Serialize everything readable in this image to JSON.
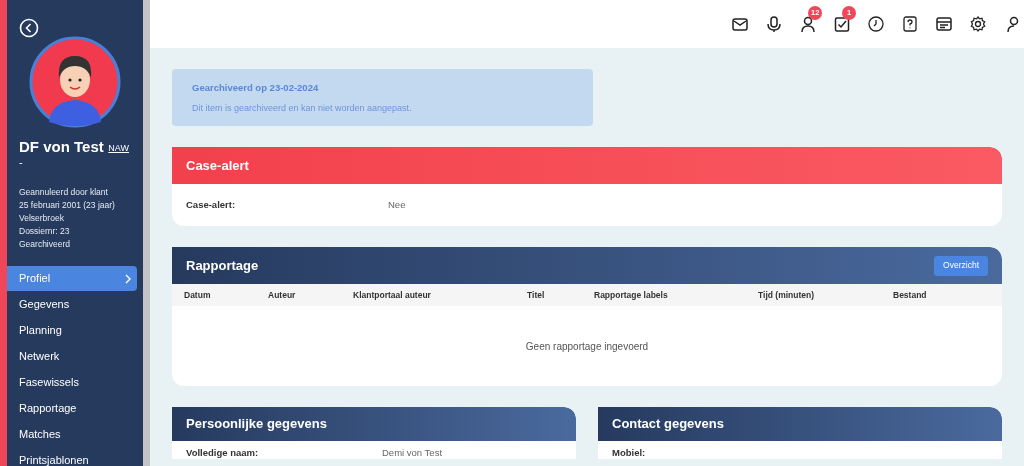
{
  "sidebar": {
    "name": "DF von Test",
    "subtitle": "-",
    "naw_link": "NAW",
    "details": [
      "Geannuleerd door klant",
      "25 februari 2001 (23 jaar)",
      "Velserbroek",
      "Dossiernr: 23",
      "Gearchiveerd"
    ],
    "items": [
      {
        "label": "Profiel",
        "selected": true
      },
      {
        "label": "Gegevens",
        "selected": false
      },
      {
        "label": "Planning",
        "selected": false
      },
      {
        "label": "Netwerk",
        "selected": false
      },
      {
        "label": "Fasewissels",
        "selected": false
      },
      {
        "label": "Rapportage",
        "selected": false
      },
      {
        "label": "Matches",
        "selected": false
      },
      {
        "label": "Printsjablonen",
        "selected": false
      }
    ]
  },
  "toolbar": [
    {
      "kind": "mail"
    },
    {
      "kind": "mic"
    },
    {
      "kind": "person",
      "badge": "12"
    },
    {
      "kind": "task",
      "badge": "1"
    },
    {
      "kind": "clock"
    },
    {
      "kind": "help"
    },
    {
      "kind": "card"
    },
    {
      "kind": "settings"
    },
    {
      "kind": "user"
    }
  ],
  "archive_notice": {
    "title": "Gearchiveerd op 23-02-2024",
    "text": "Dit item is gearchiveerd en kan niet worden aangepast."
  },
  "case_alert": {
    "title": "Case-alert",
    "label": "Case-alert:",
    "value": "Nee"
  },
  "rapportage": {
    "title": "Rapportage",
    "button": "Overzicht",
    "columns": [
      "Datum",
      "Auteur",
      "Klantportaal auteur",
      "Titel",
      "Rapportage labels",
      "Tijd (minuten)",
      "Bestand"
    ],
    "empty": "Geen rapportage ingevoerd"
  },
  "cards": [
    {
      "title": "Persoonlijke gegevens",
      "fields": [
        {
          "label": "Volledige naam:",
          "value": "Demi von Test"
        }
      ]
    },
    {
      "title": "Contact gegevens",
      "fields": [
        {
          "label": "Mobiel:"
        }
      ]
    }
  ]
}
